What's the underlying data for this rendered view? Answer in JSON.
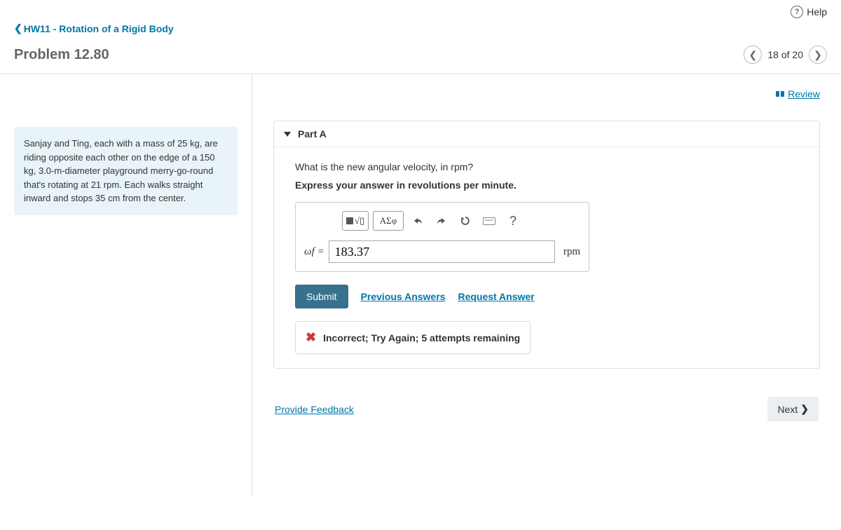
{
  "header": {
    "help": "Help",
    "breadcrumb": "HW11 - Rotation of a Rigid Body",
    "problem_title": "Problem 12.80",
    "page_indicator": "18 of 20"
  },
  "review_link": "Review",
  "problem_statement": "Sanjay and Ting, each with a mass of 25 kg, are riding opposite each other on the edge of a 150 kg, 3.0-m-diameter playground merry-go-round that's rotating at 21 rpm. Each walks straight inward and stops 35 cm from the center.",
  "part": {
    "label": "Part A",
    "question": "What is the new angular velocity, in rpm?",
    "instruction": "Express your answer in revolutions per minute.",
    "toolbar": {
      "greek": "ΑΣφ",
      "help": "?"
    },
    "input": {
      "variable": "ωf =",
      "value": "183.37",
      "unit": "rpm"
    },
    "actions": {
      "submit": "Submit",
      "previous": "Previous Answers",
      "request": "Request Answer"
    },
    "feedback": "Incorrect; Try Again; 5 attempts remaining"
  },
  "bottom": {
    "provide_feedback": "Provide Feedback",
    "next": "Next"
  }
}
